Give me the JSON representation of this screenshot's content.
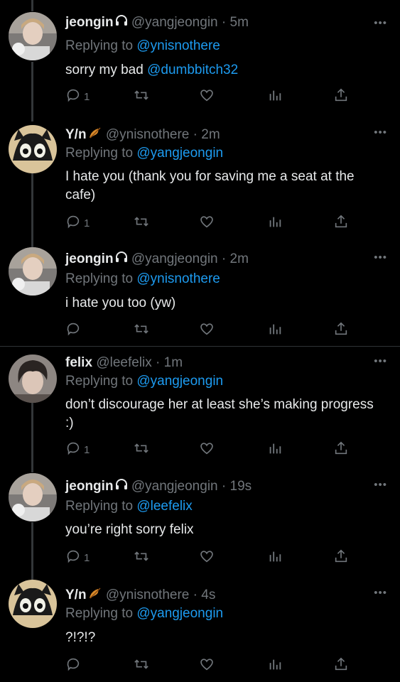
{
  "colors": {
    "background": "#000000",
    "text": "#e7e9ea",
    "muted": "#71767b",
    "accent": "#1d9bf0"
  },
  "replying_prefix": "Replying to",
  "tweets": [
    {
      "name": "jeongin",
      "name_icon": "headphones-icon",
      "handle": "@yangjeongin",
      "time": "5m",
      "replying_to": "@ynisnothere",
      "text": "sorry my bad",
      "text_mention": "@dumbbitch32",
      "reply_count": "1"
    },
    {
      "name": "Y/n",
      "name_icon": "leaf-icon",
      "handle": "@ynisnothere",
      "time": "2m",
      "replying_to": "@yangjeongin",
      "text": "I hate you (thank you for saving me a seat at the cafe)",
      "reply_count": "1"
    },
    {
      "name": "jeongin",
      "name_icon": "headphones-icon",
      "handle": "@yangjeongin",
      "time": "2m",
      "replying_to": "@ynisnothere",
      "text": "i hate you too (yw)",
      "reply_count": ""
    },
    {
      "name": "felix",
      "handle": "@leefelix",
      "time": "1m",
      "replying_to": "@yangjeongin",
      "text": "don’t discourage her at least she’s making progress :)",
      "reply_count": "1"
    },
    {
      "name": "jeongin",
      "name_icon": "headphones-icon",
      "handle": "@yangjeongin",
      "time": "19s",
      "replying_to": "@leefelix",
      "text": "you’re right sorry felix",
      "reply_count": "1"
    },
    {
      "name": "Y/n",
      "name_icon": "leaf-icon",
      "handle": "@ynisnothere",
      "time": "4s",
      "replying_to": "@yangjeongin",
      "text": "?!?!?",
      "reply_count": ""
    }
  ],
  "separator": "·",
  "more_label": "•••"
}
